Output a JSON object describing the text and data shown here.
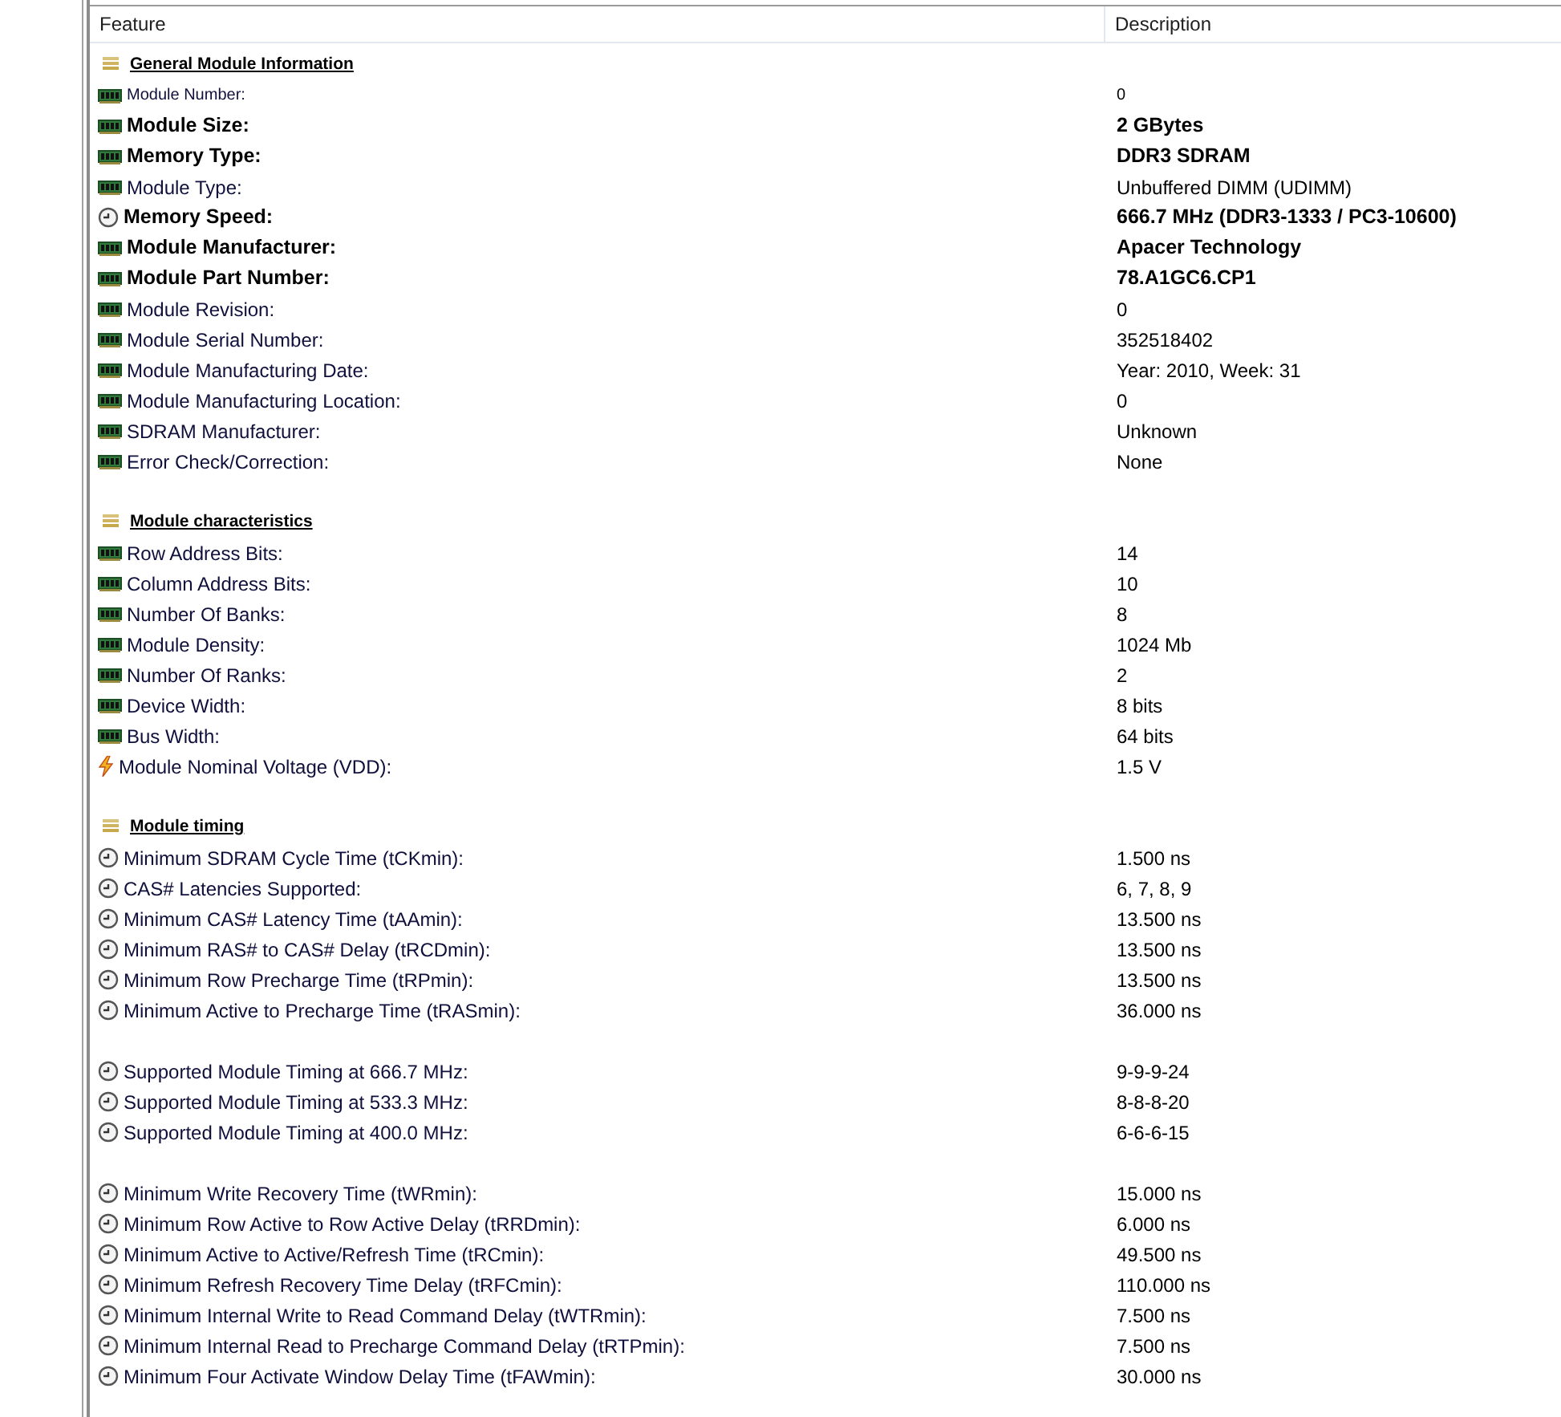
{
  "table": {
    "columns": [
      "Feature",
      "Description"
    ],
    "rows": [
      {
        "kind": "section",
        "label": "General Module Information"
      },
      {
        "kind": "chipsmall",
        "feature": "Module Number:",
        "value": "0",
        "bold": false
      },
      {
        "kind": "chip",
        "feature": "Module Size:",
        "value": "2 GBytes",
        "bold": true
      },
      {
        "kind": "chip",
        "feature": "Memory Type:",
        "value": "DDR3 SDRAM",
        "bold": true
      },
      {
        "kind": "chip",
        "feature": "Module Type:",
        "value": "Unbuffered DIMM (UDIMM)",
        "bold": false
      },
      {
        "kind": "clock",
        "feature": "Memory Speed:",
        "value": "666.7 MHz (DDR3-1333 / PC3-10600)",
        "bold": true
      },
      {
        "kind": "chip",
        "feature": "Module Manufacturer:",
        "value": "Apacer Technology",
        "bold": true
      },
      {
        "kind": "chip",
        "feature": "Module Part Number:",
        "value": "78.A1GC6.CP1",
        "bold": true
      },
      {
        "kind": "chip",
        "feature": "Module Revision:",
        "value": "0",
        "bold": false
      },
      {
        "kind": "chip",
        "feature": "Module Serial Number:",
        "value": "352518402",
        "bold": false
      },
      {
        "kind": "chip",
        "feature": "Module Manufacturing Date:",
        "value": "Year: 2010, Week: 31",
        "bold": false
      },
      {
        "kind": "chip",
        "feature": "Module Manufacturing Location:",
        "value": "0",
        "bold": false
      },
      {
        "kind": "chip",
        "feature": "SDRAM Manufacturer:",
        "value": "Unknown",
        "bold": false
      },
      {
        "kind": "chip",
        "feature": "Error Check/Correction:",
        "value": "None",
        "bold": false
      },
      {
        "kind": "spacer"
      },
      {
        "kind": "section",
        "label": "Module characteristics"
      },
      {
        "kind": "chip",
        "feature": "Row Address Bits:",
        "value": "14",
        "bold": false
      },
      {
        "kind": "chip",
        "feature": "Column Address Bits:",
        "value": "10",
        "bold": false
      },
      {
        "kind": "chip",
        "feature": "Number Of Banks:",
        "value": "8",
        "bold": false
      },
      {
        "kind": "chip",
        "feature": "Module Density:",
        "value": "1024 Mb",
        "bold": false
      },
      {
        "kind": "chip",
        "feature": "Number Of Ranks:",
        "value": "2",
        "bold": false
      },
      {
        "kind": "chip",
        "feature": "Device Width:",
        "value": "8 bits",
        "bold": false
      },
      {
        "kind": "chip",
        "feature": "Bus Width:",
        "value": "64 bits",
        "bold": false
      },
      {
        "kind": "bolt",
        "feature": "Module Nominal Voltage (VDD):",
        "value": "1.5 V",
        "bold": false
      },
      {
        "kind": "spacer"
      },
      {
        "kind": "section",
        "label": "Module timing"
      },
      {
        "kind": "clock",
        "feature": "Minimum SDRAM Cycle Time (tCKmin):",
        "value": "1.500 ns",
        "bold": false
      },
      {
        "kind": "clock",
        "feature": "CAS# Latencies Supported:",
        "value": "6, 7, 8, 9",
        "bold": false
      },
      {
        "kind": "clock",
        "feature": "Minimum CAS# Latency Time (tAAmin):",
        "value": "13.500 ns",
        "bold": false
      },
      {
        "kind": "clock",
        "feature": "Minimum RAS# to CAS# Delay (tRCDmin):",
        "value": "13.500 ns",
        "bold": false
      },
      {
        "kind": "clock",
        "feature": "Minimum Row Precharge Time (tRPmin):",
        "value": "13.500 ns",
        "bold": false
      },
      {
        "kind": "clock",
        "feature": "Minimum Active to Precharge Time (tRASmin):",
        "value": "36.000 ns",
        "bold": false
      },
      {
        "kind": "spacer"
      },
      {
        "kind": "clock",
        "feature": "Supported Module Timing at 666.7 MHz:",
        "value": "9-9-9-24",
        "bold": false
      },
      {
        "kind": "clock",
        "feature": "Supported Module Timing at 533.3 MHz:",
        "value": "8-8-8-20",
        "bold": false
      },
      {
        "kind": "clock",
        "feature": "Supported Module Timing at 400.0 MHz:",
        "value": "6-6-6-15",
        "bold": false
      },
      {
        "kind": "spacer"
      },
      {
        "kind": "clock",
        "feature": "Minimum Write Recovery Time (tWRmin):",
        "value": "15.000 ns",
        "bold": false
      },
      {
        "kind": "clock",
        "feature": "Minimum Row Active to Row Active Delay (tRRDmin):",
        "value": "6.000 ns",
        "bold": false
      },
      {
        "kind": "clock",
        "feature": "Minimum Active to Active/Refresh Time (tRCmin):",
        "value": "49.500 ns",
        "bold": false
      },
      {
        "kind": "clock",
        "feature": "Minimum Refresh Recovery Time Delay (tRFCmin):",
        "value": "110.000 ns",
        "bold": false
      },
      {
        "kind": "clock",
        "feature": "Minimum Internal Write to Read Command Delay (tWTRmin):",
        "value": "7.500 ns",
        "bold": false
      },
      {
        "kind": "clock",
        "feature": "Minimum Internal Read to Precharge Command Delay (tRTPmin):",
        "value": "7.500 ns",
        "bold": false
      },
      {
        "kind": "clock",
        "feature": "Minimum Four Activate Window Delay Time (tFAWmin):",
        "value": "30.000 ns",
        "bold": false
      }
    ]
  }
}
